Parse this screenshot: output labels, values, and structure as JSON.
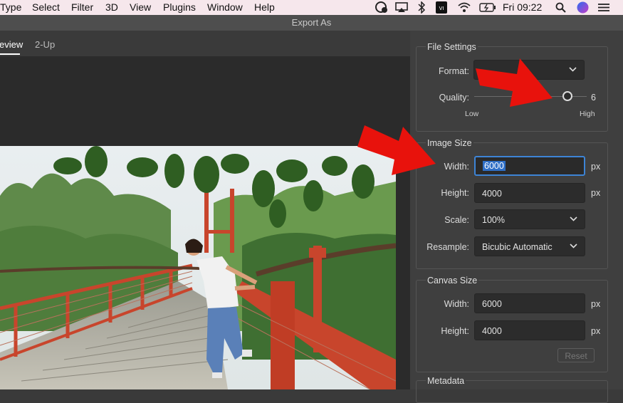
{
  "menubar": {
    "items": [
      "Type",
      "Select",
      "Filter",
      "3D",
      "View",
      "Plugins",
      "Window",
      "Help"
    ],
    "clock": "Fri 09:22"
  },
  "dialog": {
    "title": "Export As"
  },
  "preview": {
    "tabs": [
      "eview",
      "2-Up"
    ]
  },
  "file_settings": {
    "title": "File Settings",
    "format_label": "Format:",
    "format_value": "",
    "quality_label": "Quality:",
    "quality_value": "6",
    "quality_low": "Low",
    "quality_high": "High",
    "quality_fraction": 0.86
  },
  "image_size": {
    "title": "Image Size",
    "width_label": "Width:",
    "width_value": "6000",
    "height_label": "Height:",
    "height_value": "4000",
    "scale_label": "Scale:",
    "scale_value": "100%",
    "resample_label": "Resample:",
    "resample_value": "Bicubic Automatic",
    "unit": "px"
  },
  "canvas_size": {
    "title": "Canvas Size",
    "width_label": "Width:",
    "width_value": "6000",
    "height_label": "Height:",
    "height_value": "4000",
    "unit": "px",
    "reset_label": "Reset"
  },
  "metadata": {
    "title": "Metadata"
  },
  "colors": {
    "accent": "#3d84d6",
    "arrow": "#e8120c",
    "bridge": "#c8452c"
  }
}
